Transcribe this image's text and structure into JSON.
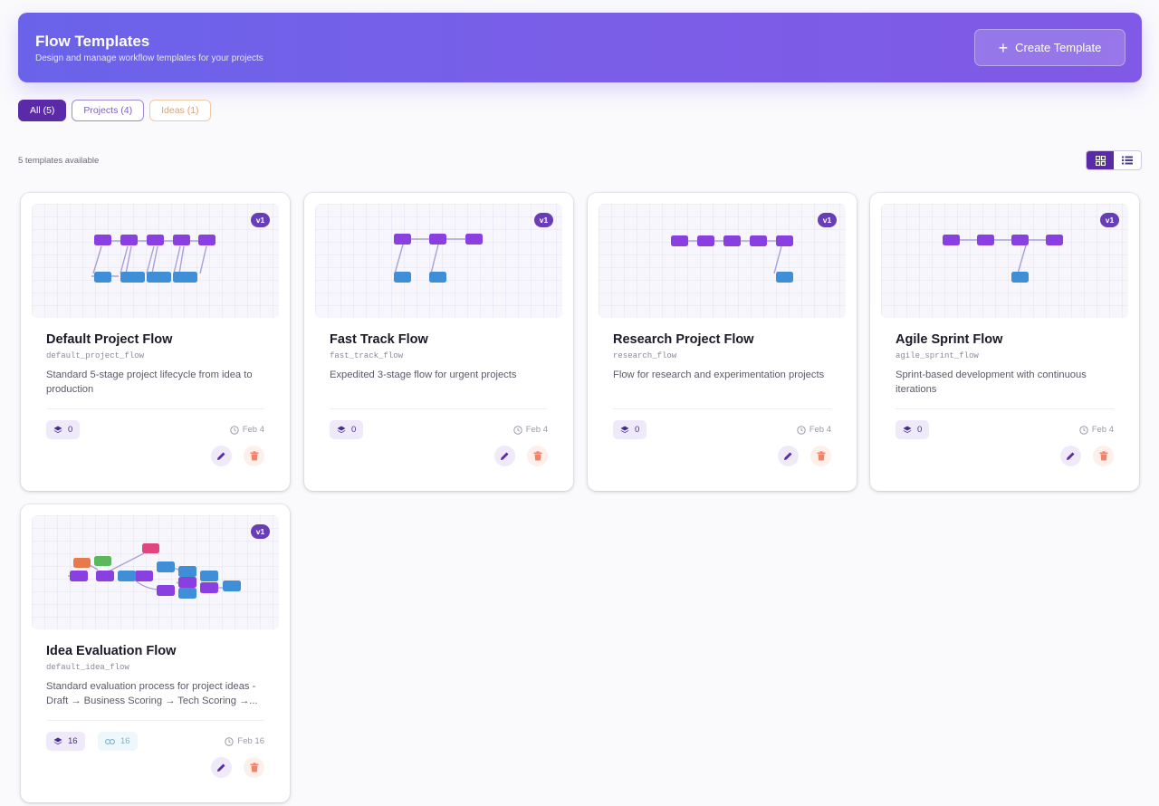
{
  "header": {
    "title": "Flow Templates",
    "subtitle": "Design and manage workflow templates for your projects",
    "create_label": "Create Template"
  },
  "filters": [
    {
      "label": "All (5)",
      "active": true
    },
    {
      "label": "Projects (4)",
      "active": false
    },
    {
      "label": "Ideas (1)",
      "active": false
    }
  ],
  "templates_count": "5 templates available",
  "view_toggle": {
    "active": "grid",
    "options": [
      "grid-icon",
      "list-icon"
    ]
  },
  "colors": {
    "accent": "#5b2aa8",
    "header_gradient": [
      "#6a63ea",
      "#8059e6"
    ],
    "node_purple": "#8a3fe0",
    "node_blue": "#3f8ed8",
    "node_orange": "#e8794a",
    "node_green": "#5cb85c",
    "node_pink": "#e0457f",
    "delete_icon": "#f0836a"
  },
  "cards": [
    {
      "version": "v1",
      "title": "Default Project Flow",
      "code": "default_project_flow",
      "description": "Standard 5-stage project lifecycle from idea to production",
      "stages": "0",
      "date": "Feb 4"
    },
    {
      "version": "v1",
      "title": "Fast Track Flow",
      "code": "fast_track_flow",
      "description": "Expedited 3-stage flow for urgent projects",
      "stages": "0",
      "date": "Feb 4"
    },
    {
      "version": "v1",
      "title": "Research Project Flow",
      "code": "research_flow",
      "description": "Flow for research and experimentation projects",
      "stages": "0",
      "date": "Feb 4"
    },
    {
      "version": "v1",
      "title": "Agile Sprint Flow",
      "code": "agile_sprint_flow",
      "description": "Sprint-based development with continuous iterations",
      "stages": "0",
      "date": "Feb 4"
    },
    {
      "version": "v1",
      "title": "Idea Evaluation Flow",
      "code": "default_idea_flow",
      "description": "Standard evaluation process for project ideas - Draft → Business Scoring → Tech Scoring →...",
      "stages": "16",
      "links": "16",
      "date": "Feb 16"
    }
  ]
}
